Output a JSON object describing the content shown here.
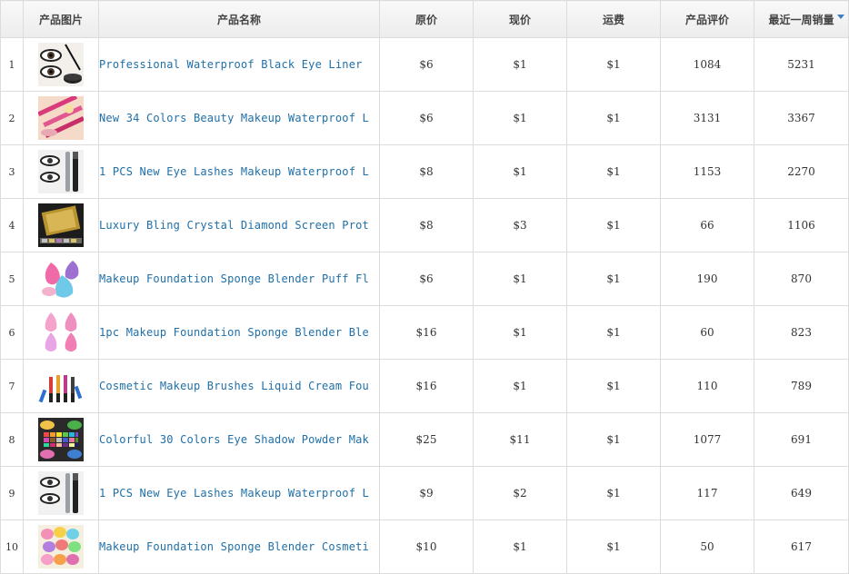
{
  "table": {
    "headers": {
      "index": "",
      "image": "产品图片",
      "name": "产品名称",
      "original_price": "原价",
      "current_price": "现价",
      "shipping": "运费",
      "reviews": "产品评价",
      "weekly_sales": "最近一周销量"
    },
    "sort": {
      "column": "weekly_sales",
      "direction": "desc",
      "icon": "sort-down-icon",
      "color": "#3a7fc0"
    },
    "link_color": "#1f6fa8",
    "rows": [
      {
        "index": "1",
        "name": "Professional Waterproof Black Eye Liner",
        "original_price": "$6",
        "current_price": "$1",
        "shipping": "$1",
        "reviews": "1084",
        "weekly_sales": "5231",
        "image": "eyeliner-photo"
      },
      {
        "index": "2",
        "name": "New 34 Colors Beauty Makeup Waterproof L",
        "original_price": "$6",
        "current_price": "$1",
        "shipping": "$1",
        "reviews": "3131",
        "weekly_sales": "3367",
        "image": "lip-pencils-photo"
      },
      {
        "index": "3",
        "name": "1 PCS New Eye Lashes Makeup Waterproof L",
        "original_price": "$8",
        "current_price": "$1",
        "shipping": "$1",
        "reviews": "1153",
        "weekly_sales": "2270",
        "image": "mascara-photo"
      },
      {
        "index": "4",
        "name": "Luxury Bling Crystal Diamond Screen Prot",
        "original_price": "$8",
        "current_price": "$3",
        "shipping": "$1",
        "reviews": "66",
        "weekly_sales": "1106",
        "image": "phone-screen-photo"
      },
      {
        "index": "5",
        "name": "Makeup Foundation Sponge Blender Puff Fl",
        "original_price": "$6",
        "current_price": "$1",
        "shipping": "$1",
        "reviews": "190",
        "weekly_sales": "870",
        "image": "sponges-photo"
      },
      {
        "index": "6",
        "name": "1pc Makeup Foundation Sponge Blender Ble",
        "original_price": "$16",
        "current_price": "$1",
        "shipping": "$1",
        "reviews": "60",
        "weekly_sales": "823",
        "image": "pink-sponges-photo"
      },
      {
        "index": "7",
        "name": "Cosmetic Makeup Brushes Liquid Cream Fou",
        "original_price": "$16",
        "current_price": "$1",
        "shipping": "$1",
        "reviews": "110",
        "weekly_sales": "789",
        "image": "brushes-photo"
      },
      {
        "index": "8",
        "name": "Colorful 30 Colors Eye Shadow Powder Mak",
        "original_price": "$25",
        "current_price": "$11",
        "shipping": "$1",
        "reviews": "1077",
        "weekly_sales": "691",
        "image": "eyeshadow-palette-photo"
      },
      {
        "index": "9",
        "name": "1 PCS New Eye Lashes Makeup Waterproof L",
        "original_price": "$9",
        "current_price": "$2",
        "shipping": "$1",
        "reviews": "117",
        "weekly_sales": "649",
        "image": "mascara-photo"
      },
      {
        "index": "10",
        "name": "Makeup Foundation Sponge Blender Cosmeti",
        "original_price": "$10",
        "current_price": "$1",
        "shipping": "$1",
        "reviews": "50",
        "weekly_sales": "617",
        "image": "sponge-set-photo"
      }
    ]
  }
}
